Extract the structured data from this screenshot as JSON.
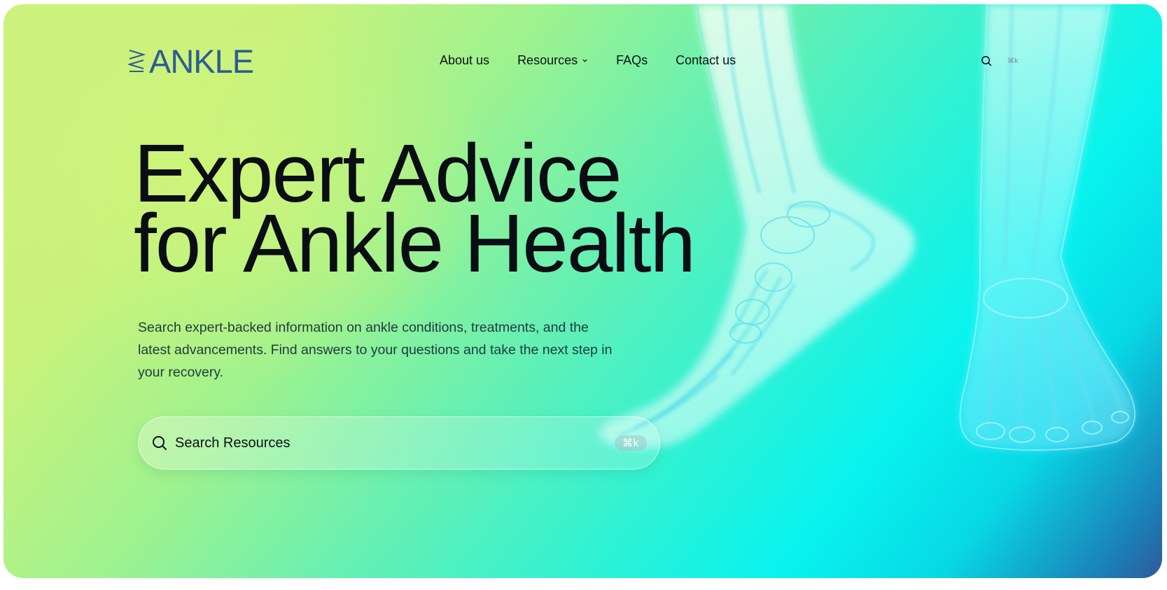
{
  "brand": {
    "logo_text": "ANKLE",
    "logo_color": "#2d5c96"
  },
  "nav": {
    "items": [
      {
        "label": "About us"
      },
      {
        "label": "Resources",
        "has_dropdown": true
      },
      {
        "label": "FAQs"
      },
      {
        "label": "Contact us"
      }
    ]
  },
  "header_search": {
    "icon": "search-icon",
    "shortcut": "⌘k"
  },
  "hero": {
    "title_line1": "Expert Advice",
    "title_line2": "for Ankle Health",
    "subtitle": "Search expert-backed information on ankle conditions, treatments, and the latest advancements. Find answers to your questions and take the next step in your recovery.",
    "image": "x-ray-feet"
  },
  "search": {
    "placeholder": "Search Resources",
    "shortcut": "⌘k",
    "icon": "search-icon"
  },
  "colors": {
    "gradient_start": "#cdf27c",
    "gradient_mid": "#08f3ef",
    "gradient_end": "#2f5a9a",
    "text_dark": "#0a0d14"
  }
}
